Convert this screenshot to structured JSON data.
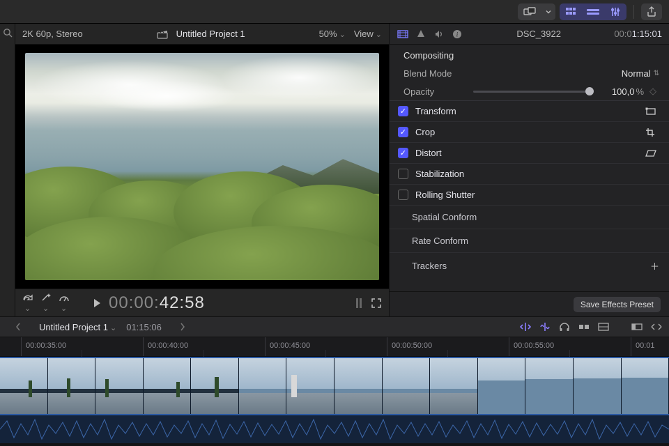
{
  "toolbar": {
    "icons": [
      "layout-overlap",
      "chevron-down",
      "grid",
      "list-row",
      "sliders",
      "share"
    ]
  },
  "viewer": {
    "format": "2K 60p, Stereo",
    "project_title": "Untitled Project 1",
    "zoom": "50%",
    "view_label": "View"
  },
  "transport": {
    "time_prefix": "00:00:",
    "time_big": "42:58",
    "tool_icons": [
      "arrow-redo",
      "wand",
      "gauge"
    ]
  },
  "inspector": {
    "clip_name": "DSC_3922",
    "clip_tc_dim": "00:0",
    "clip_tc_hl": "1:15:01",
    "section": "Compositing",
    "blend_label": "Blend Mode",
    "blend_value": "Normal",
    "opacity_label": "Opacity",
    "opacity_value": "100,0",
    "opacity_unit": "%",
    "toggles": [
      {
        "label": "Transform",
        "checked": true,
        "icon": "rect"
      },
      {
        "label": "Crop",
        "checked": true,
        "icon": "crop"
      },
      {
        "label": "Distort",
        "checked": true,
        "icon": "parallelogram"
      },
      {
        "label": "Stabilization",
        "checked": false,
        "icon": ""
      },
      {
        "label": "Rolling Shutter",
        "checked": false,
        "icon": ""
      }
    ],
    "subrows": [
      "Spatial Conform",
      "Rate Conform",
      "Trackers"
    ],
    "save_preset": "Save Effects Preset"
  },
  "projectbar": {
    "name": "Untitled Project 1",
    "duration": "01:15:06"
  },
  "ruler": {
    "labels": [
      "00:00:35:00",
      "00:00:40:00",
      "00:00:45:00",
      "00:00:50:00",
      "00:00:55:00",
      "00:01"
    ]
  }
}
